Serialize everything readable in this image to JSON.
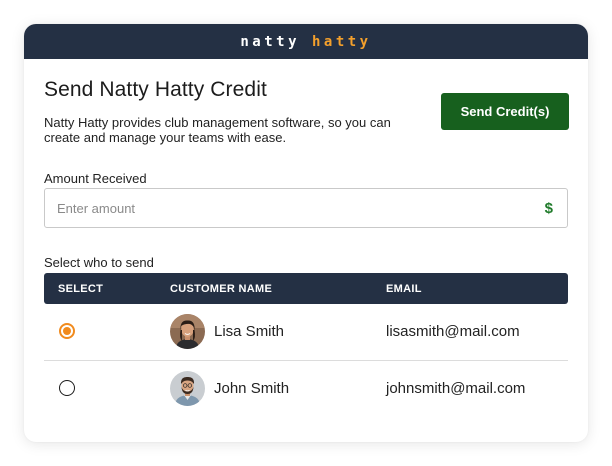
{
  "brand": {
    "word1": "natty",
    "word2": "hatty"
  },
  "page": {
    "title": "Send Natty Hatty Credit",
    "description": "Natty Hatty provides club management software, so you can create and manage your teams with ease.",
    "send_button": "Send Credit(s)"
  },
  "amount": {
    "label": "Amount Received",
    "placeholder": "Enter amount",
    "value": "",
    "currency_symbol": "$"
  },
  "recipients": {
    "label": "Select who to send",
    "columns": [
      "SELECT",
      "CUSTOMER NAME",
      "EMAIL"
    ],
    "rows": [
      {
        "name": "Lisa Smith",
        "email": "lisasmith@mail.com",
        "selected": true
      },
      {
        "name": "John Smith",
        "email": "johnsmith@mail.com",
        "selected": false
      }
    ]
  },
  "colors": {
    "header_bg": "#243044",
    "accent_orange": "#f4a02c",
    "button_green": "#17601e",
    "currency_green": "#1f7a2a"
  }
}
